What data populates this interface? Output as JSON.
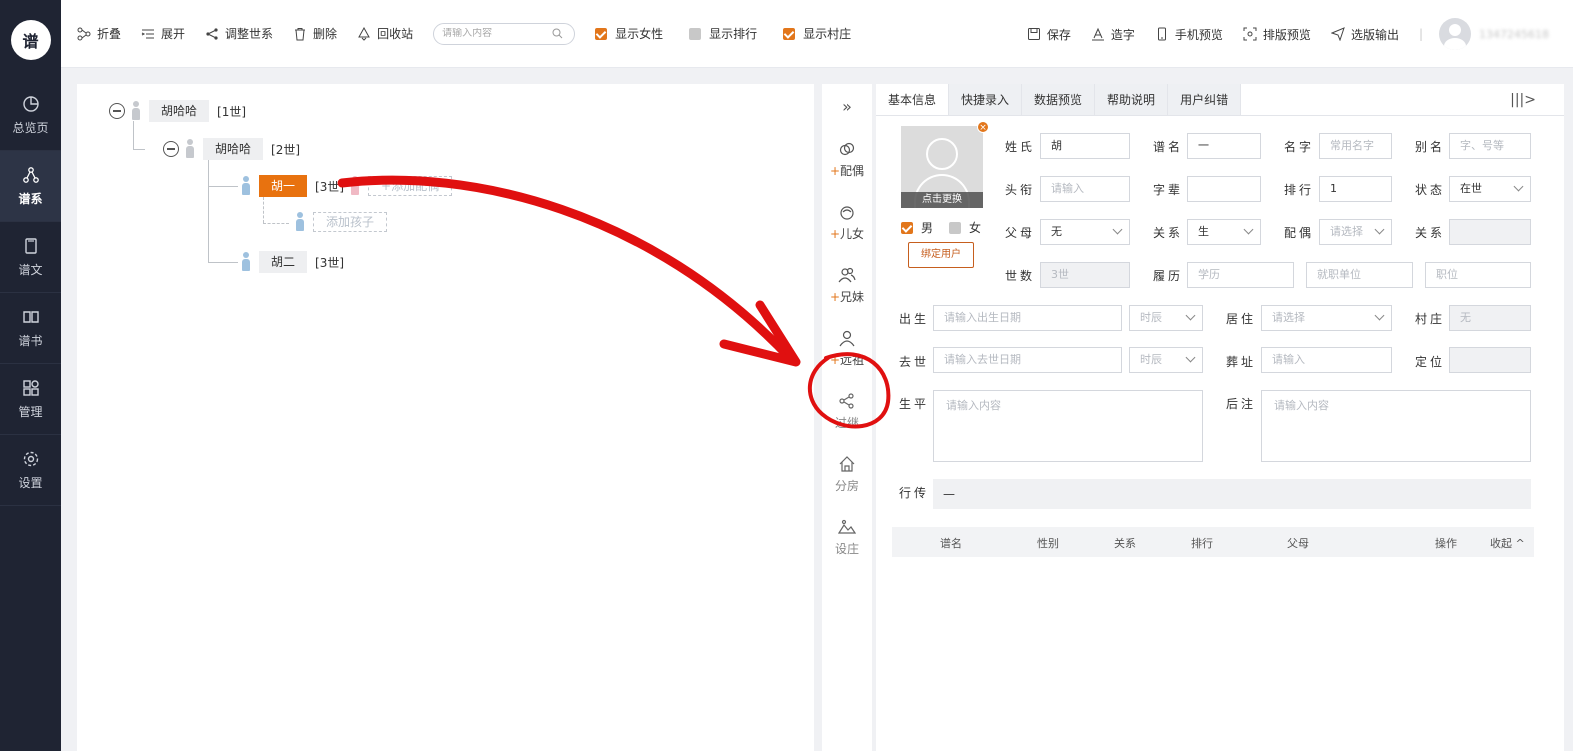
{
  "sidebar": {
    "logo_text": "谱",
    "items": [
      {
        "label": "总览页"
      },
      {
        "label": "谱系"
      },
      {
        "label": "谱文"
      },
      {
        "label": "谱书"
      },
      {
        "label": "管理"
      },
      {
        "label": "设置"
      }
    ],
    "active_index": 1
  },
  "toolbar": {
    "fold": "折叠",
    "expand": "展开",
    "adjust_gen": "调整世系",
    "delete": "删除",
    "recycle": "回收站",
    "search_placeholder": "请输入内容",
    "show_female": "显示女性",
    "show_rank": "显示排行",
    "show_village": "显示村庄",
    "save": "保存",
    "create_char": "造字",
    "mobile_preview": "手机预览",
    "layout_preview": "排版预览",
    "export": "选版输出",
    "separator": "|",
    "username": "1347245618"
  },
  "checkboxes": {
    "show_female": true,
    "show_rank": false,
    "show_village": true
  },
  "tree": {
    "nodes": [
      {
        "name": "胡哈哈",
        "gen": "[1世]"
      },
      {
        "name": "胡哈哈",
        "gen": "[2世]"
      },
      {
        "name": "胡一",
        "gen": "[3世]",
        "add_spouse": "+添加配偶",
        "add_child": "添加孩子"
      },
      {
        "name": "胡二",
        "gen": "[3世]"
      }
    ]
  },
  "mid": {
    "expand_icon": "»",
    "items": [
      {
        "label": "配偶",
        "plus": "+"
      },
      {
        "label": "儿女",
        "plus": "+"
      },
      {
        "label": "兄妹",
        "plus": "+"
      },
      {
        "label": "远祖",
        "plus": "+"
      },
      {
        "label": "过继"
      },
      {
        "label": "分房"
      },
      {
        "label": "设庄"
      }
    ]
  },
  "tabs": [
    {
      "label": "基本信息"
    },
    {
      "label": "快捷录入"
    },
    {
      "label": "数据预览"
    },
    {
      "label": "帮助说明"
    },
    {
      "label": "用户纠错"
    }
  ],
  "collapse_icon": "|||>",
  "profile": {
    "photo_caption": "点击更换",
    "photo_close": "×",
    "male": "男",
    "female": "女",
    "male_checked": true,
    "bind_user": "绑定用户"
  },
  "form": {
    "surname": {
      "label": "姓氏",
      "value": "胡"
    },
    "pu_name": {
      "label": "谱名",
      "value": "一"
    },
    "given_name": {
      "label": "名字",
      "placeholder": "常用名字"
    },
    "alias": {
      "label": "别名",
      "placeholder": "字、号等"
    },
    "title": {
      "label": "头衔",
      "placeholder": "请输入"
    },
    "zibei": {
      "label": "字辈",
      "value": ""
    },
    "rank": {
      "label": "排行",
      "value": "1"
    },
    "status": {
      "label": "状态",
      "value": "在世"
    },
    "parents": {
      "label": "父母",
      "value": "无"
    },
    "relation1": {
      "label": "关系",
      "value": "生"
    },
    "spouse": {
      "label": "配偶",
      "placeholder": "请选择"
    },
    "relation2": {
      "label": "关系",
      "value": ""
    },
    "generation": {
      "label": "世数",
      "value": "3世"
    },
    "resume": {
      "label": "履历",
      "placeholder": "学历"
    },
    "employer": {
      "placeholder": "就职单位"
    },
    "position": {
      "placeholder": "职位"
    },
    "birth": {
      "label": "出生",
      "placeholder": "请输入出生日期"
    },
    "birth_time": {
      "placeholder": "时辰"
    },
    "residence": {
      "label": "居住",
      "placeholder": "请选择"
    },
    "village": {
      "label": "村庄",
      "value": "无"
    },
    "death": {
      "label": "去世",
      "placeholder": "请输入去世日期"
    },
    "death_time": {
      "placeholder": "时辰"
    },
    "burial": {
      "label": "葬址",
      "placeholder": "请输入"
    },
    "locate": {
      "label": "定位",
      "value": ""
    },
    "biography": {
      "label": "生平",
      "placeholder": "请输入内容"
    },
    "notes": {
      "label": "后注",
      "placeholder": "请输入内容"
    },
    "hangchuan": {
      "label": "行传",
      "value": "—"
    }
  },
  "grid": {
    "columns": [
      "谱名",
      "性别",
      "关系",
      "排行",
      "父母",
      "操作"
    ],
    "collapse": "收起 ^"
  },
  "annotation_color": "#e01010"
}
